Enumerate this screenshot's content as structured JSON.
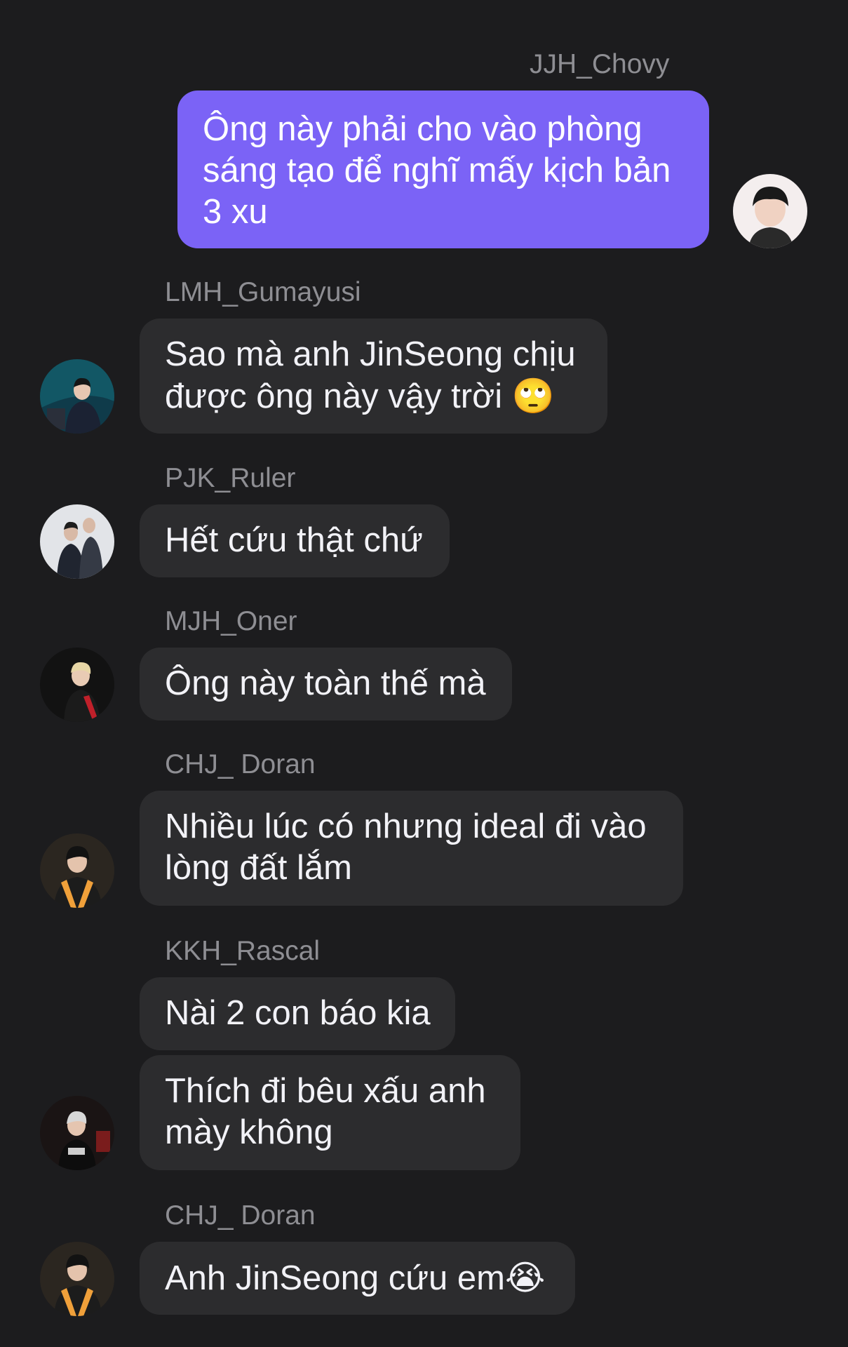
{
  "messages": [
    {
      "sender": "JJH_Chovy",
      "lines": [
        "Ông này phải cho vào phòng",
        "sáng tạo để nghĩ mấy kịch bản",
        "3 xu"
      ]
    },
    {
      "sender": "LMH_Gumayusi",
      "lines": [
        "Sao mà anh JinSeong chịu",
        "được ông này vậy trời"
      ],
      "emoji": "🙄"
    },
    {
      "sender": "PJK_Ruler",
      "lines": [
        "Hết cứu thật chứ"
      ]
    },
    {
      "sender": "MJH_Oner",
      "lines": [
        "Ông này toàn thế mà"
      ]
    },
    {
      "sender": "CHJ_ Doran",
      "lines": [
        "Nhiều lúc có nhưng ideal đi vào",
        "lòng đất lắm"
      ]
    },
    {
      "sender": "KKH_Rascal",
      "lines": [
        "Nài 2 con báo kia"
      ]
    },
    {
      "sender": "",
      "lines": [
        "Thích đi bêu xấu anh",
        "mày không"
      ]
    },
    {
      "sender": "CHJ_ Doran",
      "lines": [
        "Anh JinSeong cứu em"
      ],
      "emoji": "😭"
    }
  ],
  "colors": {
    "background": "#1c1c1e",
    "incoming_bubble": "#2c2c2e",
    "outgoing_bubble": "#7b63f6",
    "sender_name": "#8e8e93"
  }
}
